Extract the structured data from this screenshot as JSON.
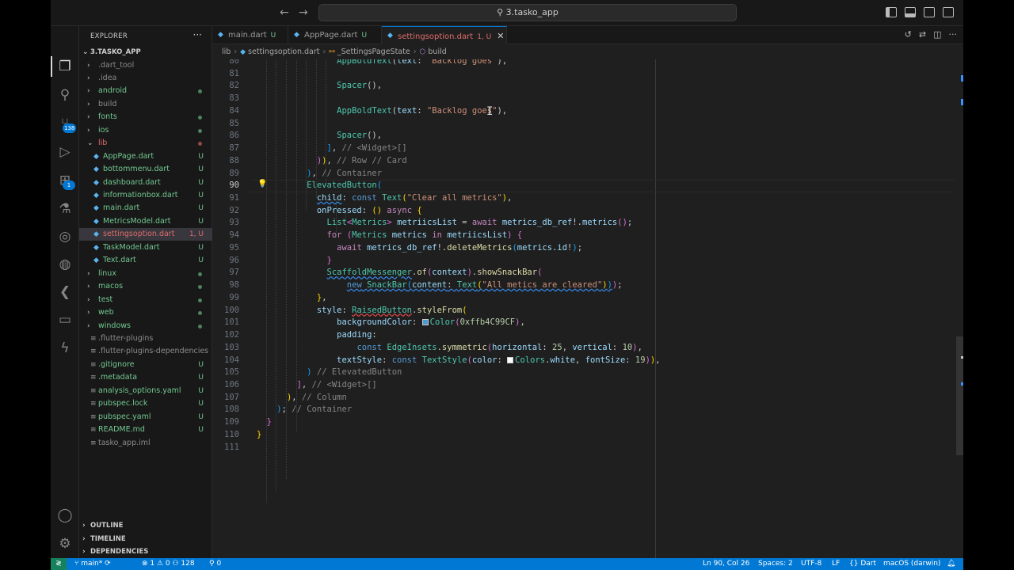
{
  "window": {
    "search_title": "3.tasko_app"
  },
  "tabs": [
    {
      "label": "main.dart",
      "status": "U",
      "active": false
    },
    {
      "label": "AppPage.dart",
      "status": "U",
      "active": false
    },
    {
      "label": "settingsoption.dart",
      "status": "1, U",
      "active": true
    }
  ],
  "breadcrumb": [
    "lib",
    "settingsoption.dart",
    "_SettingsPageState",
    "build"
  ],
  "explorer": {
    "title": "EXPLORER",
    "root": "3.TASKO_APP",
    "items": [
      {
        "label": ".dart_tool",
        "type": "folder",
        "depth": 1,
        "expanded": false,
        "status": "",
        "color": "#8b8b8b"
      },
      {
        "label": ".idea",
        "type": "folder",
        "depth": 1,
        "expanded": false,
        "status": "",
        "color": "#8b8b8b"
      },
      {
        "label": "android",
        "type": "folder",
        "depth": 1,
        "expanded": false,
        "status": "dot",
        "color": "#73c991"
      },
      {
        "label": "build",
        "type": "folder",
        "depth": 1,
        "expanded": false,
        "status": "",
        "color": "#8b8b8b"
      },
      {
        "label": "fonts",
        "type": "folder",
        "depth": 1,
        "expanded": false,
        "status": "dot",
        "color": "#73c991"
      },
      {
        "label": "ios",
        "type": "folder",
        "depth": 1,
        "expanded": false,
        "status": "dot",
        "color": "#73c991"
      },
      {
        "label": "lib",
        "type": "folder",
        "depth": 1,
        "expanded": true,
        "status": "dot-red",
        "color": "#e06c6c"
      },
      {
        "label": "AppPage.dart",
        "type": "file",
        "depth": 2,
        "status": "U",
        "color": "#73c991"
      },
      {
        "label": "bottommenu.dart",
        "type": "file",
        "depth": 2,
        "status": "U",
        "color": "#73c991"
      },
      {
        "label": "dashboard.dart",
        "type": "file",
        "depth": 2,
        "status": "U",
        "color": "#73c991"
      },
      {
        "label": "informationbox.dart",
        "type": "file",
        "depth": 2,
        "status": "U",
        "color": "#73c991"
      },
      {
        "label": "main.dart",
        "type": "file",
        "depth": 2,
        "status": "U",
        "color": "#73c991"
      },
      {
        "label": "MetricsModel.dart",
        "type": "file",
        "depth": 2,
        "status": "U",
        "color": "#73c991"
      },
      {
        "label": "settingsoption.dart",
        "type": "file",
        "depth": 2,
        "status": "1, U",
        "color": "#e06c6c",
        "selected": true
      },
      {
        "label": "TaskModel.dart",
        "type": "file",
        "depth": 2,
        "status": "U",
        "color": "#73c991"
      },
      {
        "label": "Text.dart",
        "type": "file",
        "depth": 2,
        "status": "U",
        "color": "#73c991"
      },
      {
        "label": "linux",
        "type": "folder",
        "depth": 1,
        "expanded": false,
        "status": "dot",
        "color": "#73c991"
      },
      {
        "label": "macos",
        "type": "folder",
        "depth": 1,
        "expanded": false,
        "status": "dot",
        "color": "#73c991"
      },
      {
        "label": "test",
        "type": "folder",
        "depth": 1,
        "expanded": false,
        "status": "dot",
        "color": "#73c991"
      },
      {
        "label": "web",
        "type": "folder",
        "depth": 1,
        "expanded": false,
        "status": "dot",
        "color": "#73c991"
      },
      {
        "label": "windows",
        "type": "folder",
        "depth": 1,
        "expanded": false,
        "status": "dot",
        "color": "#73c991"
      },
      {
        "label": ".flutter-plugins",
        "type": "plain",
        "depth": 1,
        "status": "",
        "color": "#8b8b8b"
      },
      {
        "label": ".flutter-plugins-dependencies",
        "type": "plain",
        "depth": 1,
        "status": "",
        "color": "#8b8b8b"
      },
      {
        "label": ".gitignore",
        "type": "plain",
        "depth": 1,
        "status": "U",
        "color": "#73c991"
      },
      {
        "label": ".metadata",
        "type": "plain",
        "depth": 1,
        "status": "U",
        "color": "#73c991"
      },
      {
        "label": "analysis_options.yaml",
        "type": "plain",
        "depth": 1,
        "status": "U",
        "color": "#73c991"
      },
      {
        "label": "pubspec.lock",
        "type": "plain",
        "depth": 1,
        "status": "U",
        "color": "#73c991"
      },
      {
        "label": "pubspec.yaml",
        "type": "plain",
        "depth": 1,
        "status": "U",
        "color": "#73c991"
      },
      {
        "label": "README.md",
        "type": "plain",
        "depth": 1,
        "status": "U",
        "color": "#73c991"
      },
      {
        "label": "tasko_app.iml",
        "type": "plain",
        "depth": 1,
        "status": "",
        "color": "#8b8b8b"
      }
    ],
    "sections": [
      "OUTLINE",
      "TIMELINE",
      "DEPENDENCIES"
    ]
  },
  "activity": {
    "scm_badge": "138",
    "ext_badge": "1"
  },
  "editor": {
    "current_line": 90,
    "lines": [
      {
        "n": "80",
        "html": "                <span class=\"t-c\">AppBoldText</span>(<span class=\"t-v\">text</span>: <span class=\"t-s\">\"Backlog goes\"</span>),",
        "indent": 0
      },
      {
        "n": "81",
        "html": ""
      },
      {
        "n": "82",
        "html": "                <span class=\"t-c\">Spacer</span>(),",
        "indent": 0
      },
      {
        "n": "83",
        "html": ""
      },
      {
        "n": "84",
        "html": "                <span class=\"t-c\">AppBoldText</span>(<span class=\"t-v\">text</span>: <span class=\"t-s\">\"Backlog goes\"</span>),",
        "indent": 0
      },
      {
        "n": "85",
        "html": ""
      },
      {
        "n": "86",
        "html": "                <span class=\"t-c\">Spacer</span>(),",
        "indent": 0
      },
      {
        "n": "87",
        "html": "              <span class=\"t-b3\">]</span>, <span class=\"t-cmt\">// &lt;Widget&gt;[]</span>"
      },
      {
        "n": "88",
        "html": "            <span class=\"t-b2\">)</span><span class=\"t-b1\">)</span>, <span class=\"t-cmt\">// Row // Card</span>"
      },
      {
        "n": "89",
        "html": "          <span class=\"t-b3\">)</span>, <span class=\"t-cmt\">// Container</span>"
      },
      {
        "n": "90",
        "html": "          <span class=\"t-c\">ElevatedButton</span><span class=\"t-b3\">(</span>"
      },
      {
        "n": "91",
        "html": "            <span class=\"t-v sq-b\">child</span>: <span class=\"t-k\">const</span> <span class=\"t-c\">Text</span><span class=\"t-b1\">(</span><span class=\"t-s\">\"Clear all metrics\"</span><span class=\"t-b1\">)</span>,"
      },
      {
        "n": "92",
        "html": "            <span class=\"t-v\">onPressed</span>: <span class=\"t-b1\">()</span> <span class=\"t-kc\">async</span> <span class=\"t-b1\">{</span>"
      },
      {
        "n": "93",
        "html": "              <span class=\"t-c\">List</span><span class=\"t-b2\">&lt;</span><span class=\"t-c\">Metrics</span><span class=\"t-b2\">&gt;</span> <span class=\"t-v\">metriicsList</span> = <span class=\"t-kc\">await</span> <span class=\"t-v\">metrics_db_ref</span>!.<span class=\"t-v\">metrics</span><span class=\"t-b2\">()</span>;"
      },
      {
        "n": "94",
        "html": "              <span class=\"t-kc\">for</span> <span class=\"t-b2\">(</span><span class=\"t-c\">Metrics</span> <span class=\"t-v\">metrics</span> <span class=\"t-kc\">in</span> <span class=\"t-v\">metriicsList</span><span class=\"t-b2\">)</span> <span class=\"t-b2\">{</span>"
      },
      {
        "n": "95",
        "html": "                <span class=\"t-kc\">await</span> <span class=\"t-v\">metrics_db_ref</span>!.<span class=\"t-f\">deleteMetrics</span><span class=\"t-b3\">(</span><span class=\"t-v\">metrics</span>.<span class=\"t-v\">id</span>!<span class=\"t-b3\">)</span>;"
      },
      {
        "n": "96",
        "html": "              <span class=\"t-b2\">}</span>"
      },
      {
        "n": "97",
        "html": "              <span class=\"t-c sq-b\">ScaffoldMessenger</span>.<span class=\"t-f\">of</span><span class=\"t-b2\">(</span><span class=\"t-v\">context</span><span class=\"t-b2\">)</span>.<span class=\"t-f\">showSnackBar</span><span class=\"t-b2\">(</span>"
      },
      {
        "n": "98",
        "html": "                  <span class=\"t-k sq-b\">new</span><span class=\"sq-b\"> </span><span class=\"t-c sq-b\">SnackBar</span><span class=\"t-b3 sq-b\">(</span><span class=\"t-v sq-b\">content</span><span class=\"sq-b\">: </span><span class=\"t-c sq-b\">Text</span><span class=\"t-b1 sq-b\">(</span><span class=\"t-s sq-b\">\"All metics are cleared\"</span><span class=\"t-b1 sq-b\">)</span><span class=\"t-b3 sq-b\">)</span><span class=\"t-b2\">)</span>;"
      },
      {
        "n": "99",
        "html": "            <span class=\"t-b1\">}</span>,"
      },
      {
        "n": "100",
        "html": "            <span class=\"t-v\">style</span>: <span class=\"t-c sq-r\">RaisedButton</span>.<span class=\"t-f\">styleFrom</span><span class=\"t-b1\">(</span>"
      },
      {
        "n": "101",
        "html": "                <span class=\"t-v\">backgroundColor</span>: <span class=\"swatch\" style=\"background:#4C99CF\"></span><span class=\"t-c\">Color</span><span class=\"t-b2\">(</span><span class=\"t-n\">0xffb4C99CF</span><span class=\"t-b2\">)</span>,"
      },
      {
        "n": "102",
        "html": "                <span class=\"t-v\">padding</span>:"
      },
      {
        "n": "103",
        "html": "                    <span class=\"t-k\">const</span> <span class=\"t-c\">EdgeInsets</span>.<span class=\"t-f\">symmetric</span><span class=\"t-b2\">(</span><span class=\"t-v\">horizontal</span>: <span class=\"t-n\">25</span>, <span class=\"t-v\">vertical</span>: <span class=\"t-n\">10</span><span class=\"t-b2\">)</span>,"
      },
      {
        "n": "104",
        "html": "                <span class=\"t-v\">textStyle</span>: <span class=\"t-k\">const</span> <span class=\"t-c\">TextStyle</span><span class=\"t-b2\">(</span><span class=\"t-v\">color</span>: <span class=\"swatch\" style=\"background:#ffffff\"></span><span class=\"t-c\">Colors</span>.<span class=\"t-v\">white</span>, <span class=\"t-v\">fontSize</span>: <span class=\"t-n\">19</span><span class=\"t-b2\">)</span><span class=\"t-b1\">)</span>,"
      },
      {
        "n": "105",
        "html": "          <span class=\"t-b3\">)</span> <span class=\"t-cmt\">// ElevatedButton</span>"
      },
      {
        "n": "106",
        "html": "        <span class=\"t-b2\">]</span>, <span class=\"t-cmt\">// &lt;Widget&gt;[]</span>"
      },
      {
        "n": "107",
        "html": "      <span class=\"t-b1\">)</span>, <span class=\"t-cmt\">// Column</span>"
      },
      {
        "n": "108",
        "html": "    <span class=\"t-b3\">)</span>; <span class=\"t-cmt\">// Container</span>"
      },
      {
        "n": "109",
        "html": "  <span class=\"t-b2\">}</span>"
      },
      {
        "n": "110",
        "html": "<span class=\"t-b1\">}</span>"
      },
      {
        "n": "111",
        "html": ""
      }
    ]
  },
  "statusbar": {
    "branch": "main*",
    "problems": "⊗ 1 ⚠ 0 ⚇ 128",
    "ports": "⚲ 0",
    "position": "Ln 90, Col 26",
    "spaces": "Spaces: 2",
    "encoding": "UTF-8",
    "eol": "LF",
    "language": "Dart",
    "platform": "macOS (darwin)"
  },
  "colors": {
    "accent": "#0078d4",
    "untracked": "#73c991",
    "error": "#e06c6c"
  }
}
